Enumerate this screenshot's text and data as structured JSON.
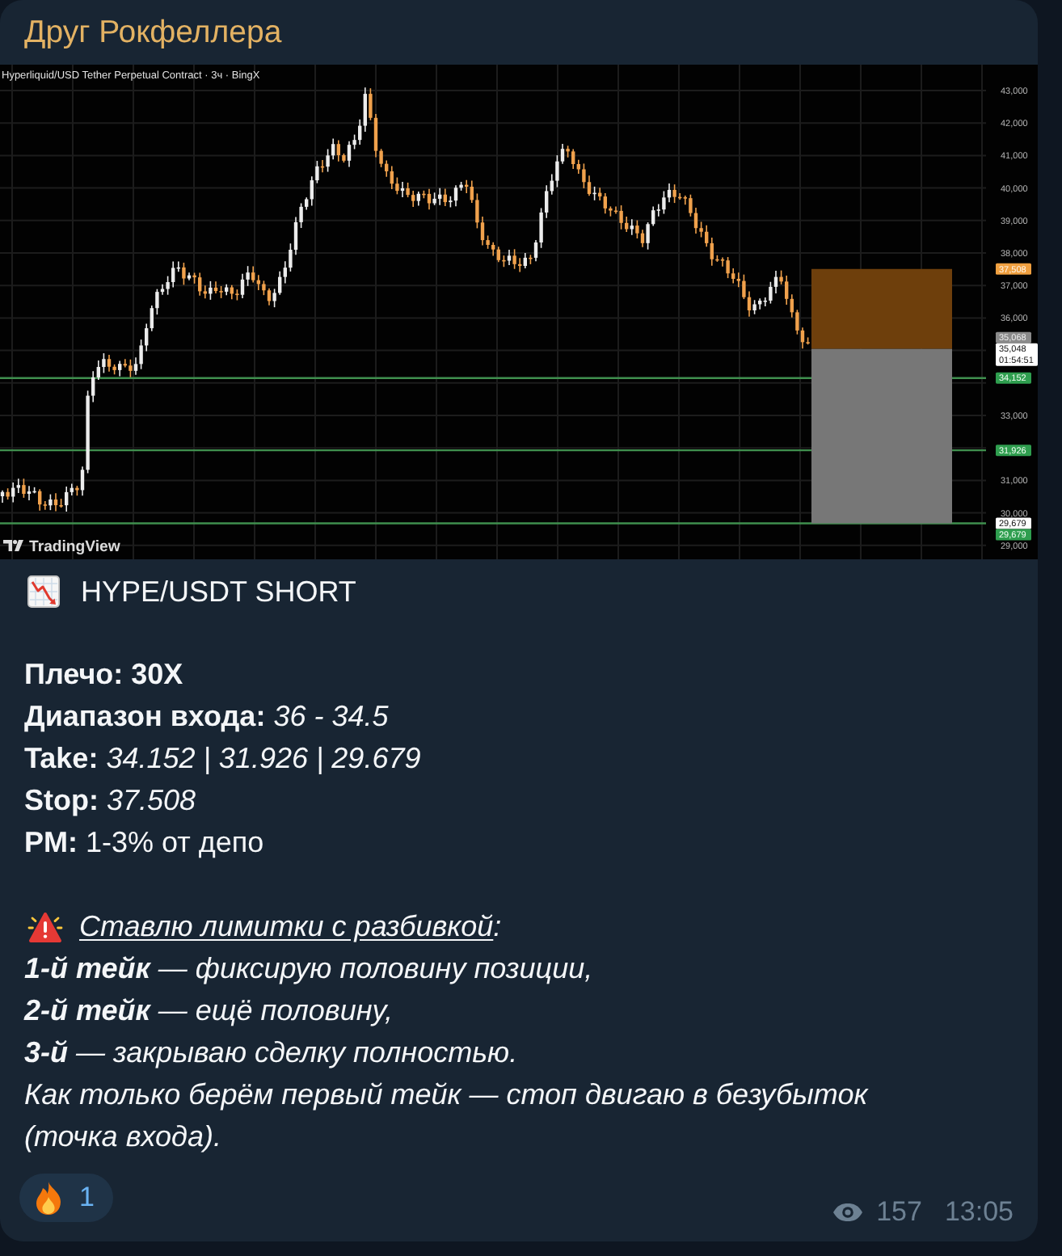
{
  "channel": {
    "name": "Друг Рокфеллера"
  },
  "chart": {
    "title": "Hyperliquid/USD Tether Perpetual Contract · 3ч · BingX",
    "price_scale": [
      "43,000",
      "42,000",
      "41,000",
      "40,000",
      "39,000",
      "38,000",
      "37,000",
      "36,000",
      "33,000",
      "31,000",
      "30,000",
      "29,000"
    ],
    "price_tags": [
      {
        "kind": "stop",
        "text": "37,508"
      },
      {
        "kind": "close",
        "text": "35,068"
      },
      {
        "kind": "last",
        "text": "35,048",
        "countdown": "01:54:51"
      },
      {
        "kind": "target",
        "text": "34,152"
      },
      {
        "kind": "target",
        "text": "31,926"
      },
      {
        "kind": "marker",
        "text": "29,679"
      },
      {
        "kind": "target",
        "text": "29,679"
      }
    ],
    "logo_text": "TradingView"
  },
  "post": {
    "title": "HYPE/USDT SHORT",
    "params": [
      {
        "kind": "leverage",
        "label": "Плечо:",
        "value": "30X"
      },
      {
        "kind": "entry",
        "label": "Диапазон входа:",
        "value": "36 - 34.5"
      },
      {
        "kind": "take",
        "label": "Take:",
        "value": "34.152 | 31.926 | 29.679"
      },
      {
        "kind": "stop",
        "label": "Stop:",
        "value": "37.508"
      },
      {
        "kind": "risk",
        "label": "PM:",
        "value": "1-3% от депо"
      }
    ],
    "notice": {
      "heading": "Ставлю лимитки с разбивкой",
      "heading_end": ":",
      "lines": [
        "**1-й тейк** — фиксирую половину позиции,",
        "**2-й тейк** — ещё половину,",
        "**3-й** — закрываю сделку полностью.",
        "Как только берём первый тейк — стоп двигаю в безубыток (точка входа)."
      ]
    }
  },
  "reactions": [
    {
      "count": "1",
      "selected": false
    }
  ],
  "footer": {
    "views": "157",
    "time": "13:05"
  }
}
